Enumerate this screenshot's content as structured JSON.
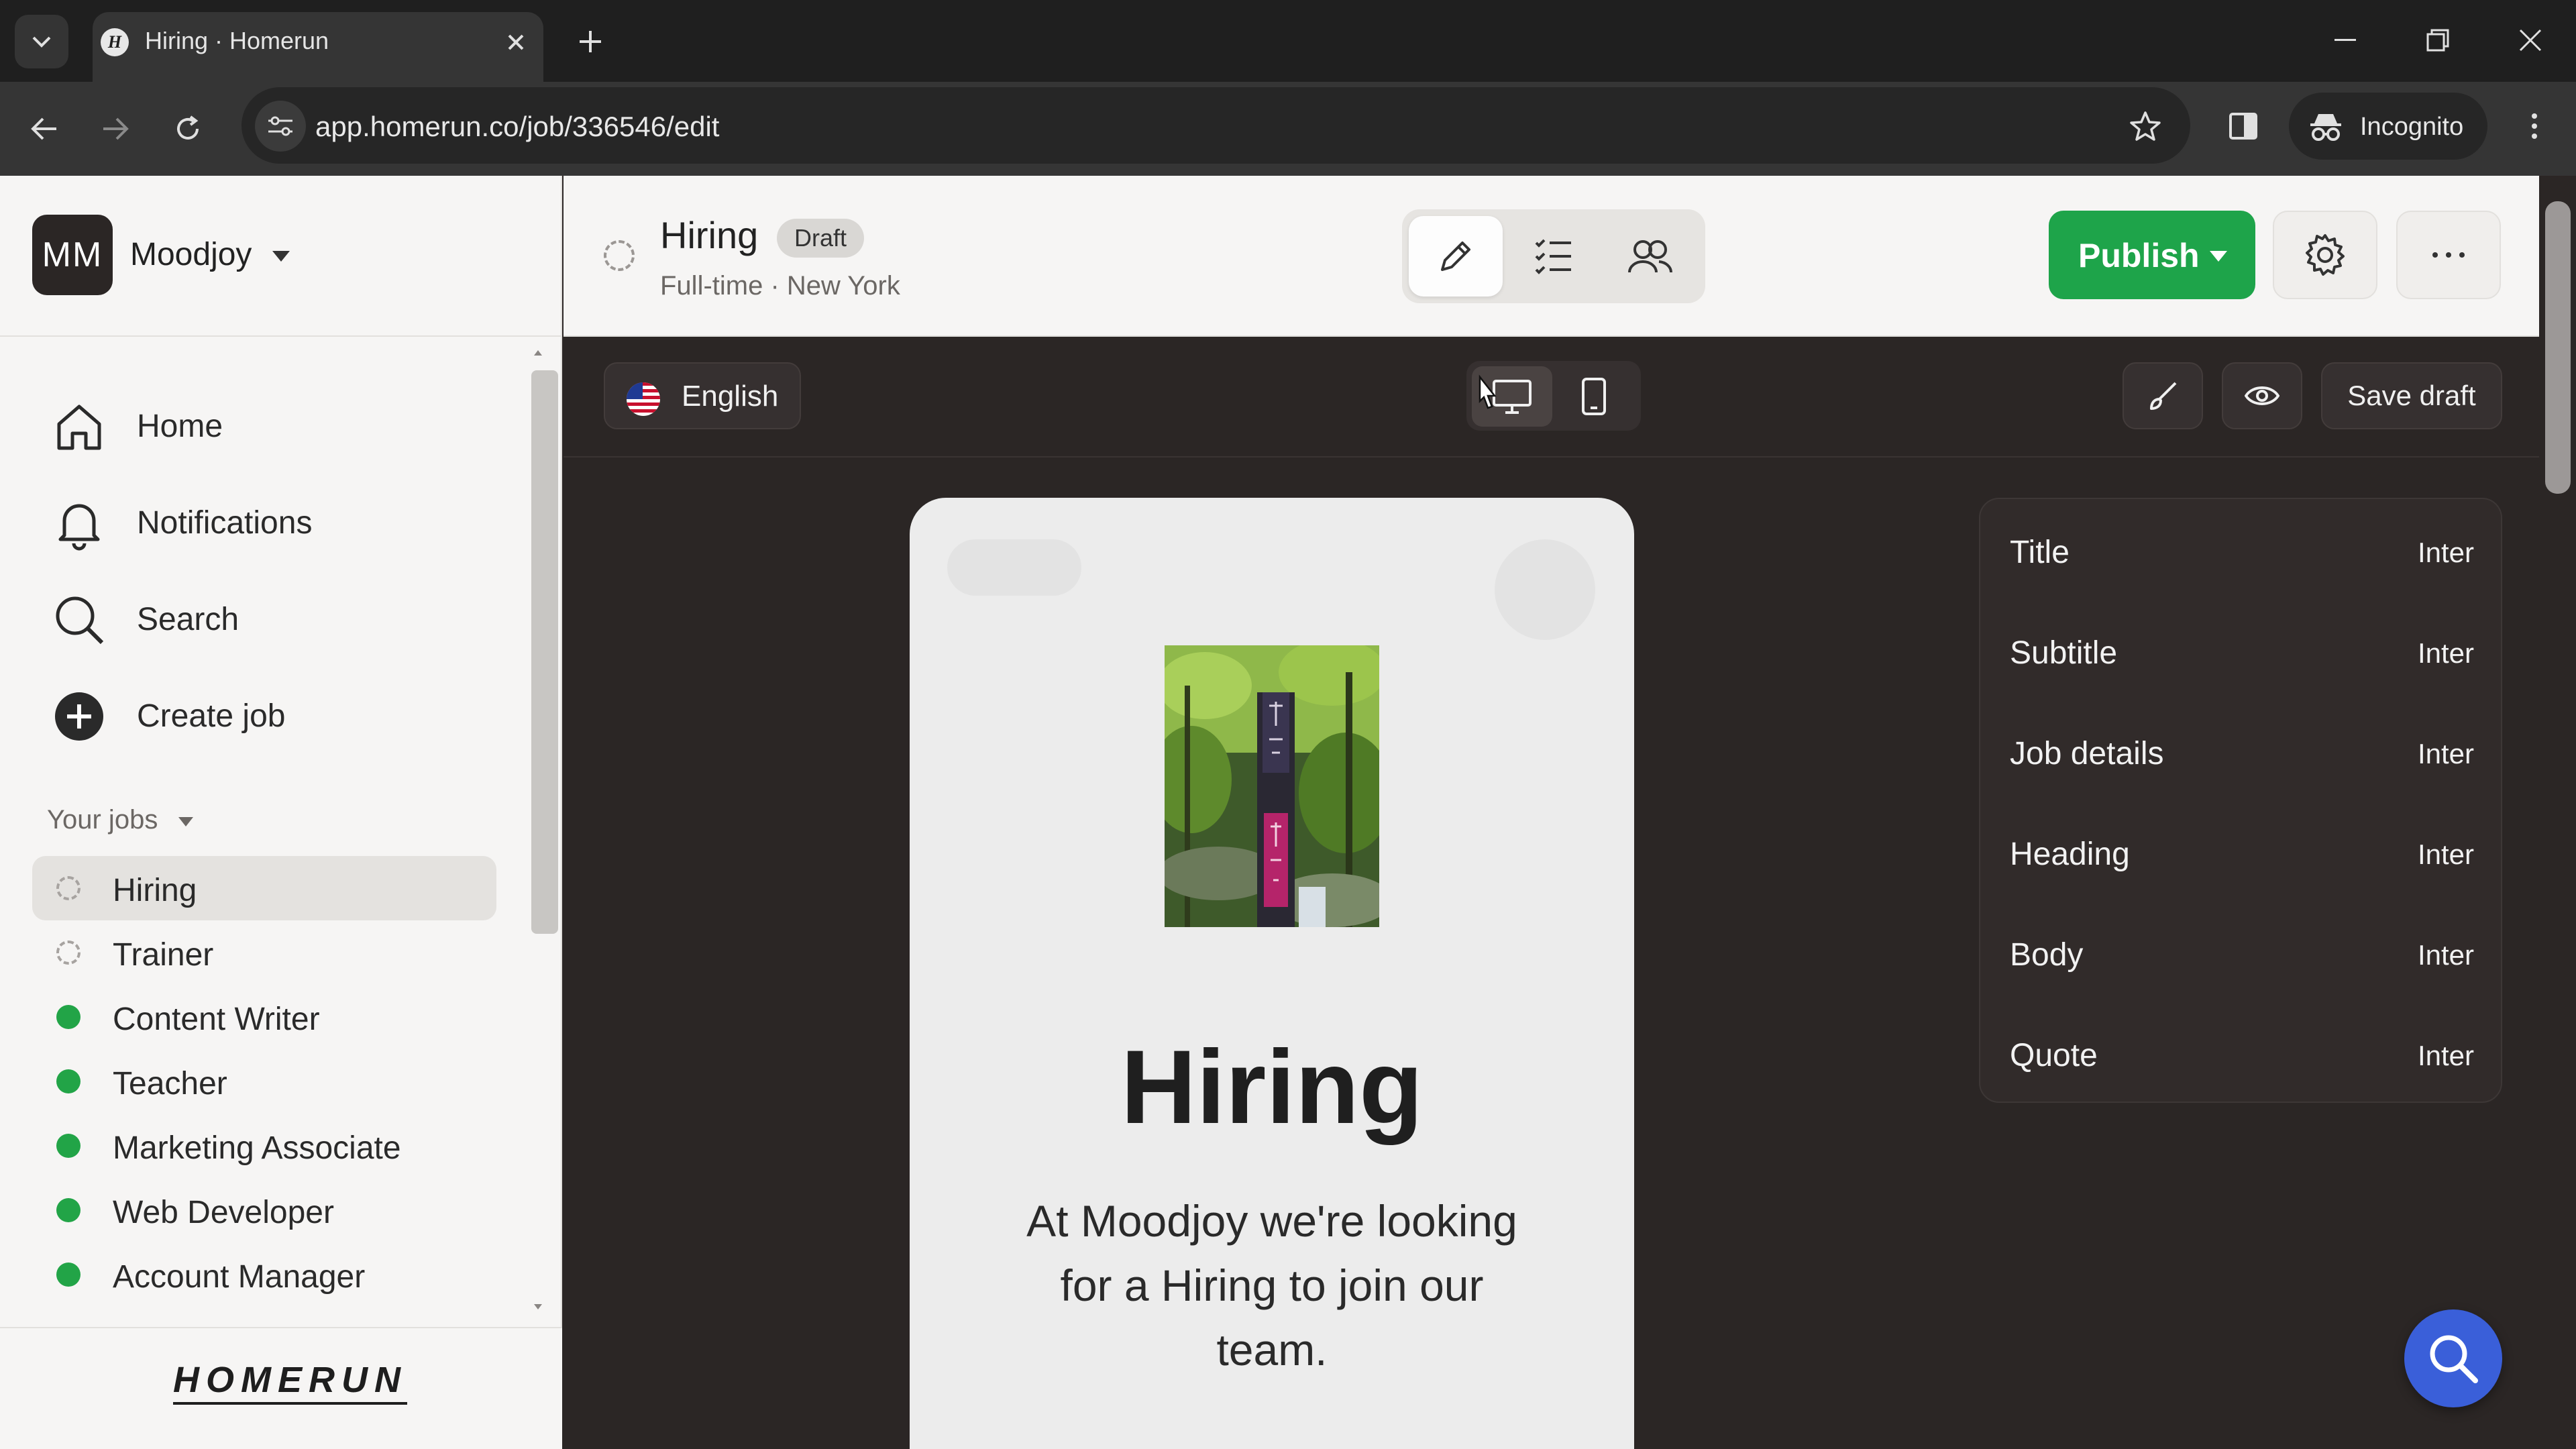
{
  "browser": {
    "tab_title": "Hiring · Homerun",
    "favicon_letter": "H",
    "url": "app.homerun.co/job/336546/edit",
    "incognito_label": "Incognito"
  },
  "workspace": {
    "initials": "MM",
    "name": "Moodjoy"
  },
  "nav": {
    "home": "Home",
    "notifications": "Notifications",
    "search": "Search",
    "create_job": "Create job"
  },
  "jobs_header": "Your jobs",
  "jobs": [
    {
      "label": "Hiring",
      "status": "draft"
    },
    {
      "label": "Trainer",
      "status": "draft"
    },
    {
      "label": "Content Writer",
      "status": "published"
    },
    {
      "label": "Teacher",
      "status": "published"
    },
    {
      "label": "Marketing Associate",
      "status": "published"
    },
    {
      "label": "Web Developer",
      "status": "published"
    },
    {
      "label": "Account Manager",
      "status": "published"
    }
  ],
  "logo_text": "HOMERUN",
  "header": {
    "title": "Hiring",
    "badge": "Draft",
    "subtitle": "Full-time · New York",
    "publish_label": "Publish"
  },
  "editor": {
    "language": "English",
    "save_draft_label": "Save draft"
  },
  "preview": {
    "title": "Hiring",
    "body": "At Moodjoy we're looking for a Hiring to join our team."
  },
  "fonts": [
    {
      "label": "Title",
      "value": "Inter"
    },
    {
      "label": "Subtitle",
      "value": "Inter"
    },
    {
      "label": "Job details",
      "value": "Inter"
    },
    {
      "label": "Heading",
      "value": "Inter"
    },
    {
      "label": "Body",
      "value": "Inter"
    },
    {
      "label": "Quote",
      "value": "Inter"
    }
  ],
  "colors": {
    "publish_green": "#1ea44a",
    "canvas_dark": "#2b2625",
    "help_blue": "#3a5fd9"
  }
}
